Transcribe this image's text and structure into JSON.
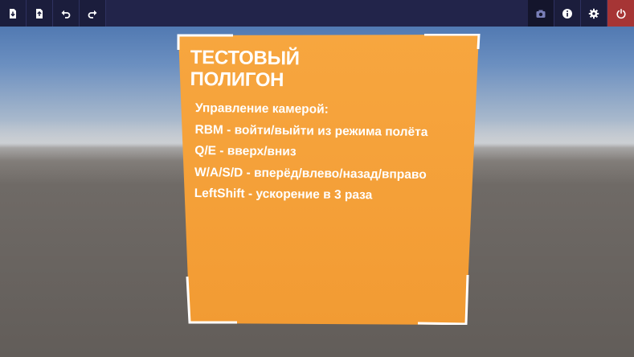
{
  "toolbar": {
    "left_buttons": [
      "download-icon",
      "upload-icon",
      "undo-icon",
      "redo-icon"
    ],
    "right_buttons": [
      "camera-icon",
      "info-icon",
      "gear-icon",
      "power-icon"
    ],
    "exit_color": "#a63535"
  },
  "sign": {
    "color": "#f5a33c",
    "title": "ТЕСТОВЫЙ\nПОЛИГОН",
    "lines": [
      "Управление камерой:",
      "RBM - войти/выйти из режима полёта",
      "Q/E - вверх/вниз",
      "W/A/S/D - вперёд/влево/назад/вправо",
      "LeftShift - ускорение в 3 раза"
    ]
  }
}
